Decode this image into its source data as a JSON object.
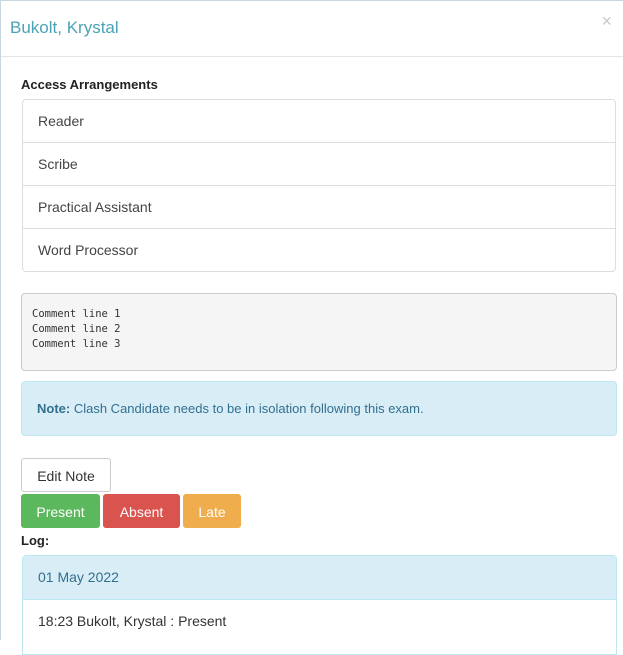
{
  "modal": {
    "title": "Bukolt, Krystal",
    "close_symbol": "×"
  },
  "access_arrangements": {
    "label": "Access Arrangements",
    "items": [
      "Reader",
      "Scribe",
      "Practical Assistant",
      "Word Processor"
    ]
  },
  "comments": [
    "Comment line 1",
    "Comment line 2",
    "Comment line 3"
  ],
  "note": {
    "label": "Note:",
    "text": " Clash Candidate needs to be in isolation following this exam."
  },
  "buttons": {
    "edit_note": "Edit Note",
    "present": "Present",
    "absent": "Absent",
    "late": "Late"
  },
  "log": {
    "label": "Log:",
    "date": "01 May 2022",
    "entries": [
      "18:23 Bukolt, Krystal : Present"
    ]
  },
  "colors": {
    "title": "#4aa3b5",
    "present": "#5cb85c",
    "absent": "#d9534f",
    "late": "#f0ad4e",
    "info_bg": "#d9edf7"
  }
}
